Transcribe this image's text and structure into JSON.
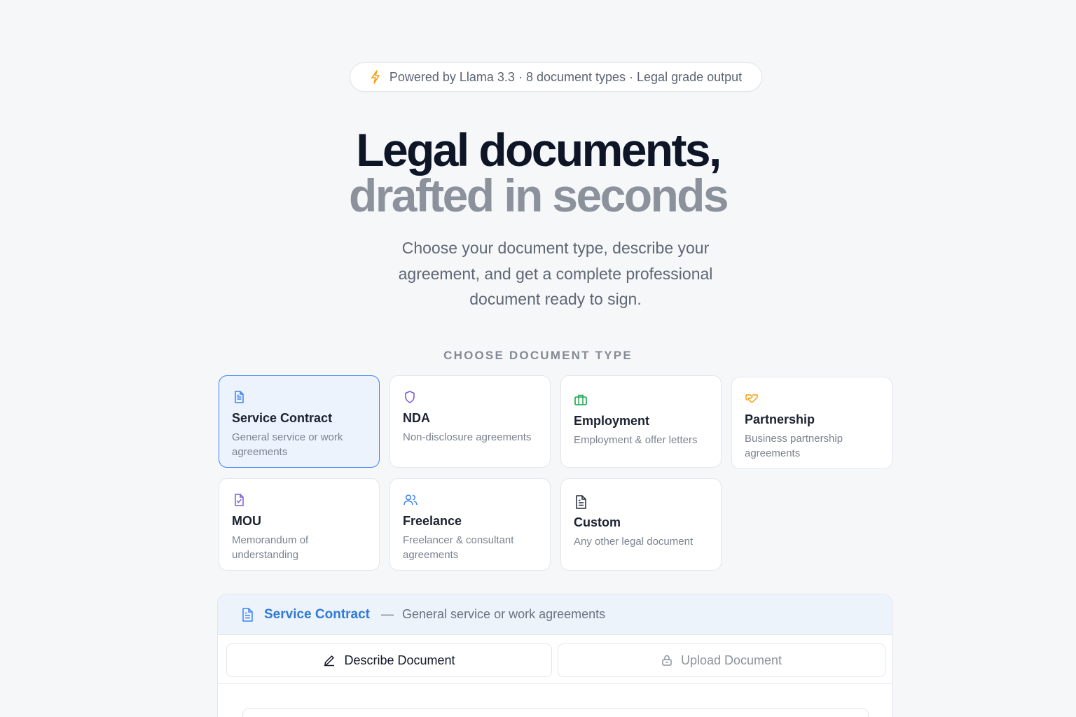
{
  "badge": {
    "text": "Powered by Llama 3.3 · 8 document types · Legal grade output",
    "icon": "bolt-icon"
  },
  "hero": {
    "line1": "Legal documents,",
    "line2": "drafted in seconds",
    "subtitle": "Choose your document type, describe your agreement, and get a complete professional document ready to sign."
  },
  "section_label": "CHOOSE DOCUMENT TYPE",
  "doc_types": [
    {
      "title": "Service Contract",
      "desc": "General service or work agreements",
      "icon": "document-icon",
      "selected": true
    },
    {
      "title": "NDA",
      "desc": "Non-disclosure agreements",
      "icon": "shield-icon"
    },
    {
      "title": "Employment",
      "desc": "Employment & offer letters",
      "icon": "briefcase-icon"
    },
    {
      "title": "Partnership",
      "desc": "Business partnership agreements",
      "icon": "handshake-icon"
    },
    {
      "title": "MOU",
      "desc": "Memorandum of understanding",
      "icon": "document-check-icon"
    },
    {
      "title": "Freelance",
      "desc": "Freelancer & consultant agreements",
      "icon": "users-icon"
    },
    {
      "title": "Custom",
      "desc": "Any other legal document",
      "icon": "document-icon"
    }
  ],
  "panel": {
    "title": "Service Contract",
    "separator": "—",
    "desc": "General service or work agreements",
    "tabs": [
      {
        "label": "Describe Document",
        "icon": "pencil-icon",
        "active": true
      },
      {
        "label": "Upload Document",
        "icon": "lock-icon",
        "active": false
      }
    ]
  },
  "colors": {
    "accent": "#3b82f6",
    "heading": "#0d1526",
    "heading_muted": "#8c929c",
    "background": "#f6f7f9"
  }
}
